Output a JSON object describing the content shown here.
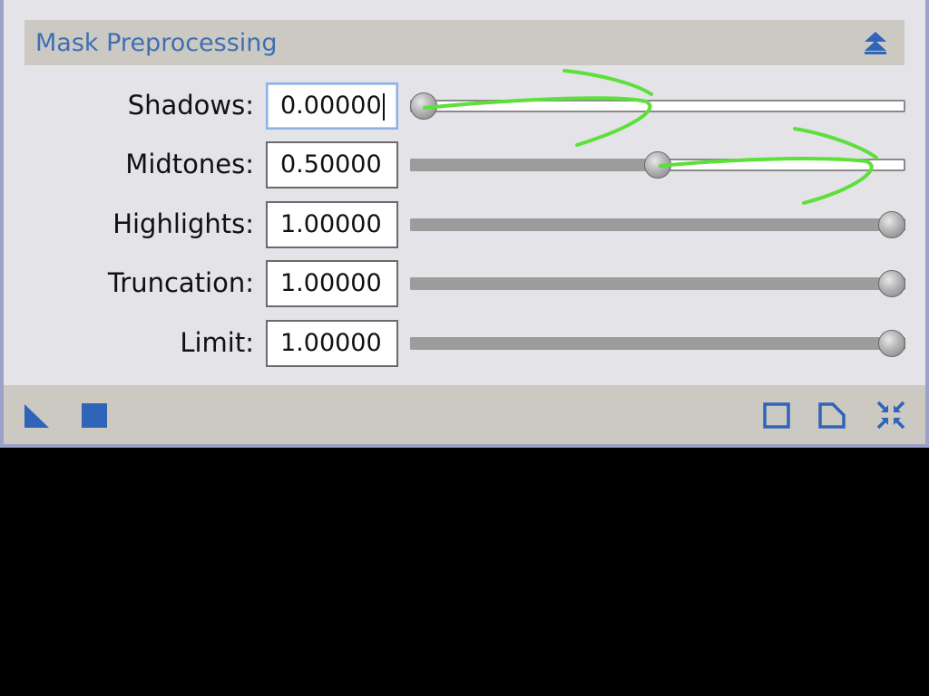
{
  "section": {
    "title": "Mask Preprocessing",
    "collapse_icon": "collapse-up-icon"
  },
  "rows": [
    {
      "label": "Shadows:",
      "value": "0.00000",
      "slider_fraction": 0.0,
      "focused": true
    },
    {
      "label": "Midtones:",
      "value": "0.50000",
      "slider_fraction": 0.5,
      "focused": false
    },
    {
      "label": "Highlights:",
      "value": "1.00000",
      "slider_fraction": 1.0,
      "focused": false
    },
    {
      "label": "Truncation:",
      "value": "1.00000",
      "slider_fraction": 1.0,
      "focused": false
    },
    {
      "label": "Limit:",
      "value": "1.00000",
      "slider_fraction": 1.0,
      "focused": false
    }
  ],
  "footer": {
    "left_icons": [
      "new-instance-icon",
      "apply-icon"
    ],
    "right_icons": [
      "preview-icon",
      "description-icon",
      "reset-icon"
    ]
  },
  "colors": {
    "accent": "#3d6fb4",
    "panel_bg": "#e3e3e8",
    "header_bg": "#ccc9c3",
    "annotation": "#5ce03a"
  }
}
